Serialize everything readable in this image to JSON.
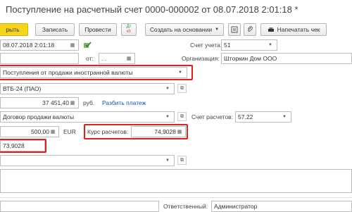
{
  "window": {
    "title": "Поступление на расчетный счет 0000-000002 от 08.07.2018 2:01:18 *"
  },
  "toolbar": {
    "post_close_label": "рыть",
    "save_label": "Записать",
    "post_label": "Провести",
    "dtkt_top": "Дт",
    "dtkt_bottom": "кт",
    "create_based_label": "Создать на основании",
    "print_receipt_label": "Напечатать чек"
  },
  "form": {
    "date_value": "08.07.2018  2:01:18",
    "account_label": "Счет учета:",
    "account_value": "51",
    "from_label": "от:",
    "from_value": " .  .",
    "org_label": "Организация:",
    "org_value": "Шторкин Дом ООО",
    "operation_value": "Поступления от продажи иностранной валюты",
    "bank_value": "ВТБ-24 (ПАО)",
    "amount_value": "37 451,40",
    "currency_unit": "руб.",
    "split_payment_link": "Разбить платеж",
    "contract_value": "Договор продажи валюты",
    "settlement_account_label": "Счет расчетов:",
    "settlement_account_value": "57.22",
    "currency_amount_value": "500,00",
    "currency_code": "EUR",
    "rate_label": "Курс расчетов:",
    "rate_value": "74,9028",
    "rate2_value": "73,9028",
    "responsible_label": "Ответственный:",
    "responsible_value": "Администратор"
  }
}
